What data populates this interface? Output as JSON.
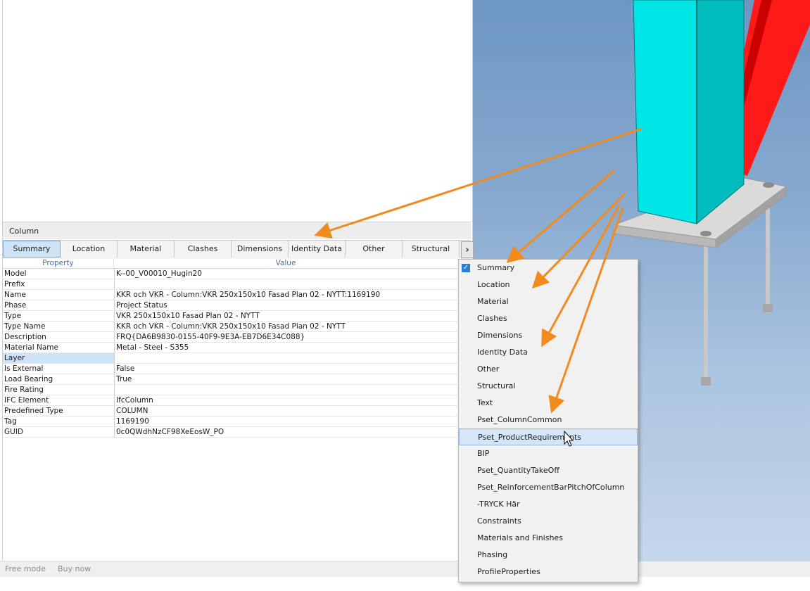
{
  "panel": {
    "title": "Column"
  },
  "tabs": [
    "Summary",
    "Location",
    "Material",
    "Clashes",
    "Dimensions",
    "Identity Data",
    "Other",
    "Structural"
  ],
  "tab_scroll_glyph": "›",
  "grid": {
    "headers": {
      "property": "Property",
      "value": "Value"
    },
    "rows": [
      {
        "property": "Model",
        "value": "K--00_V00010_Hugin20"
      },
      {
        "property": "Prefix",
        "value": ""
      },
      {
        "property": "Name",
        "value": "KKR och VKR - Column:VKR 250x150x10 Fasad Plan 02 - NYTT:1169190"
      },
      {
        "property": "Phase",
        "value": "Project Status"
      },
      {
        "property": "Type",
        "value": "VKR 250x150x10 Fasad Plan 02 - NYTT"
      },
      {
        "property": "Type Name",
        "value": "KKR och VKR - Column:VKR 250x150x10 Fasad Plan 02 - NYTT"
      },
      {
        "property": "Description",
        "value": "FRQ{DA6B9830-0155-40F9-9E3A-EB7D6E34C088}"
      },
      {
        "property": "Material Name",
        "value": "Metal - Steel - S355"
      },
      {
        "property": "Layer",
        "value": ""
      },
      {
        "property": "Is External",
        "value": "False"
      },
      {
        "property": "Load Bearing",
        "value": "True"
      },
      {
        "property": "Fire Rating",
        "value": ""
      },
      {
        "property": "IFC Element",
        "value": "IfcColumn"
      },
      {
        "property": "Predefined Type",
        "value": "COLUMN"
      },
      {
        "property": "Tag",
        "value": "1169190"
      },
      {
        "property": "GUID",
        "value": "0c0QWdhNzCF98XeEosW_PO"
      }
    ]
  },
  "menu": {
    "check_glyph": "✓",
    "items": [
      {
        "label": "Summary",
        "checked": true
      },
      {
        "label": "Location"
      },
      {
        "label": "Material"
      },
      {
        "label": "Clashes"
      },
      {
        "label": "Dimensions"
      },
      {
        "label": "Identity Data"
      },
      {
        "label": "Other"
      },
      {
        "label": "Structural"
      },
      {
        "label": "Text"
      },
      {
        "label": "Pset_ColumnCommon"
      },
      {
        "label": "Pset_ProductRequirements",
        "highlighted": true
      },
      {
        "label": "BIP"
      },
      {
        "label": "Pset_QuantityTakeOff"
      },
      {
        "label": "Pset_ReinforcementBarPitchOfColumn"
      },
      {
        "label": "-TRYCK Här"
      },
      {
        "label": "Constraints"
      },
      {
        "label": "Materials and Finishes"
      },
      {
        "label": "Phasing"
      },
      {
        "label": "ProfileProperties"
      }
    ]
  },
  "status": {
    "free_mode": "Free mode",
    "buy_now": "Buy now"
  },
  "colors": {
    "column": "#00e5e5",
    "brace": "#ff1a1a",
    "arrow": "#f28a1e",
    "baseplate": "#d6d6d6",
    "tab_active": "#cfe3f6"
  }
}
